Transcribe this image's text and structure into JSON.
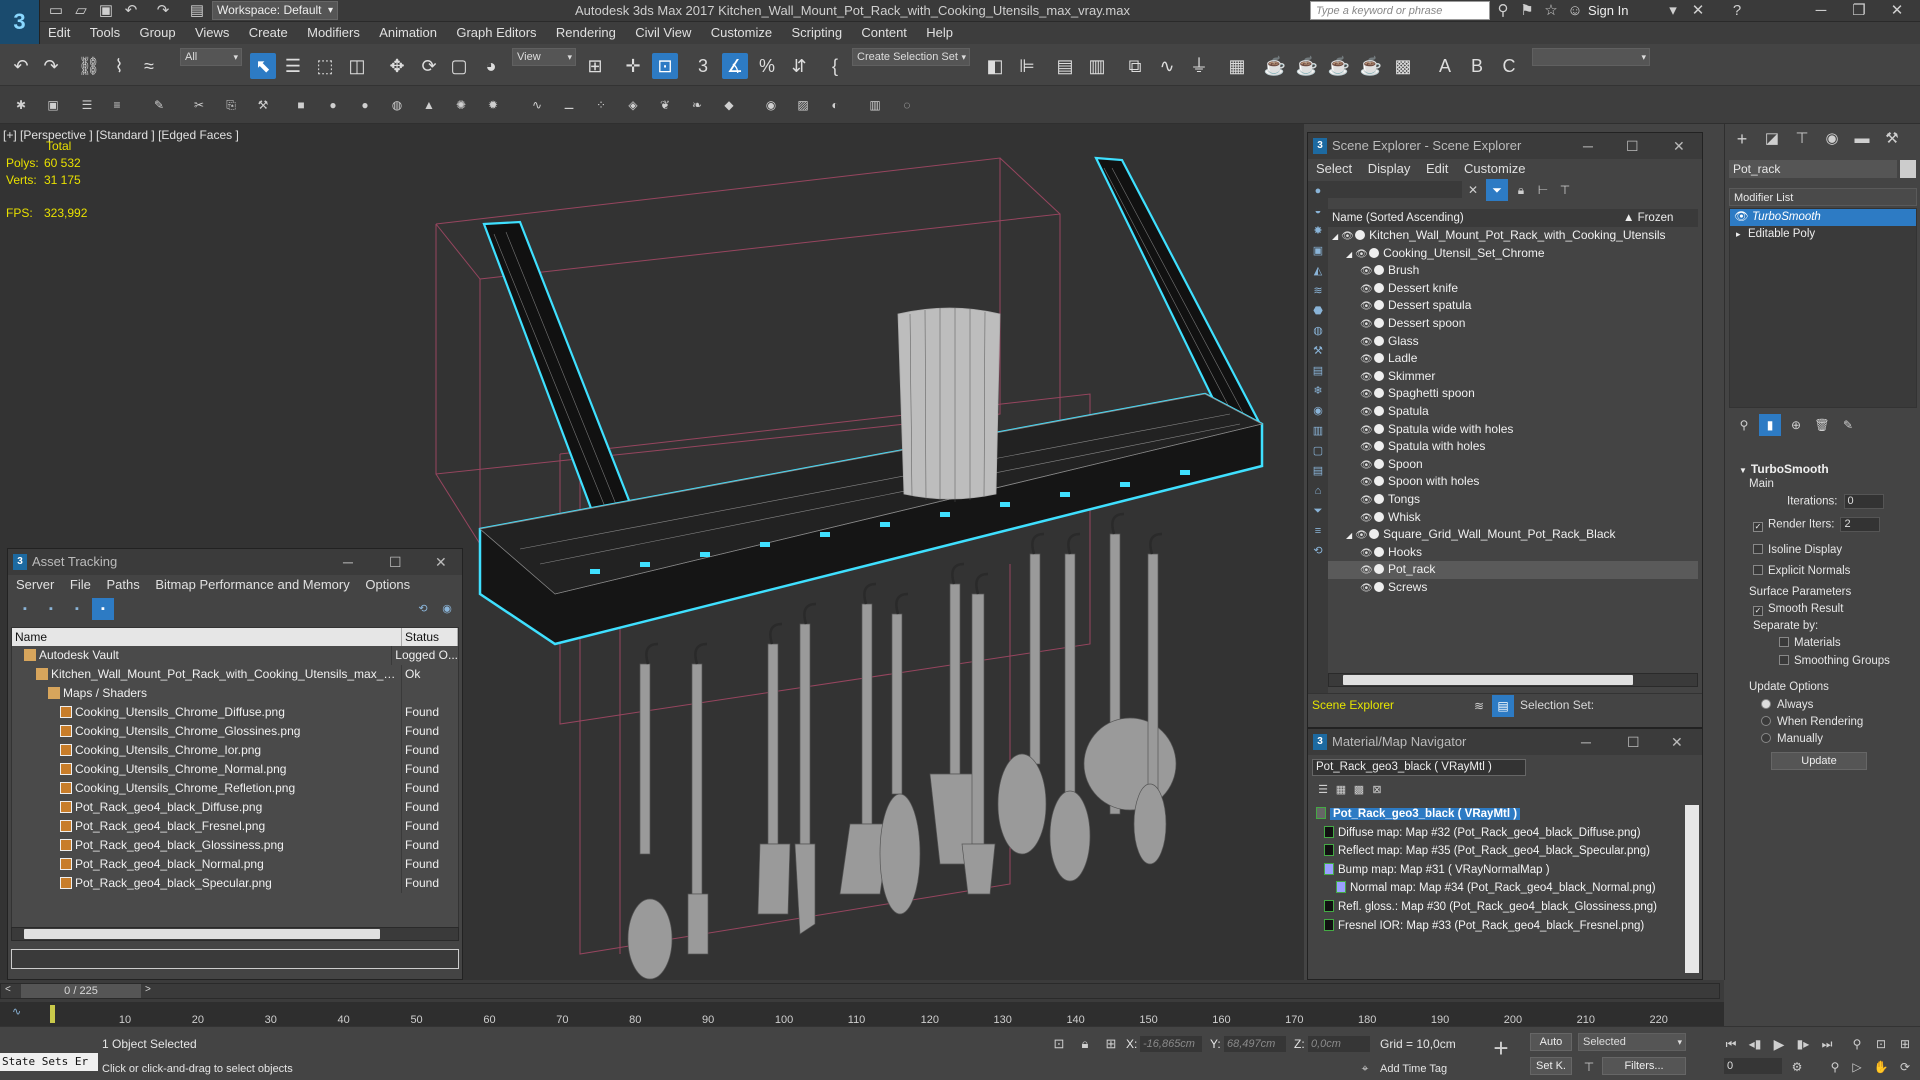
{
  "title_bar": {
    "workspace": "Workspace: Default",
    "app_title": "Autodesk 3ds Max 2017      Kitchen_Wall_Mount_Pot_Rack_with_Cooking_Utensils_max_vray.max",
    "search_placeholder": "Type a keyword or phrase",
    "sign_in": "Sign In"
  },
  "menu": [
    "Edit",
    "Tools",
    "Group",
    "Views",
    "Create",
    "Modifiers",
    "Animation",
    "Graph Editors",
    "Rendering",
    "Civil View",
    "Customize",
    "Scripting",
    "Content",
    "Help"
  ],
  "toolbar": {
    "filter": "All",
    "ref_coord": "View",
    "selection_set": "Create Selection Set"
  },
  "viewport": {
    "label": "[+] [Perspective ] [Standard ] [Edged Faces ]",
    "stats_total": "Total",
    "polys_label": "Polys:",
    "polys": "60 532",
    "verts_label": "Verts:",
    "verts": "31 175",
    "fps_label": "FPS:",
    "fps": "323,992"
  },
  "asset_tracking": {
    "title": "Asset Tracking",
    "menu": [
      "Server",
      "File",
      "Paths",
      "Bitmap Performance and Memory",
      "Options"
    ],
    "col_name": "Name",
    "col_status": "Status",
    "rows": [
      {
        "name": "Autodesk Vault",
        "status": "Logged O...",
        "indent": 1,
        "kind": "vault"
      },
      {
        "name": "Kitchen_Wall_Mount_Pot_Rack_with_Cooking_Utensils_max_vra...",
        "status": "Ok",
        "indent": 2,
        "kind": "max"
      },
      {
        "name": "Maps / Shaders",
        "status": "",
        "indent": 3,
        "kind": "folder"
      },
      {
        "name": "Cooking_Utensils_Chrome_Diffuse.png",
        "status": "Found",
        "indent": 4,
        "kind": "file"
      },
      {
        "name": "Cooking_Utensils_Chrome_Glossines.png",
        "status": "Found",
        "indent": 4,
        "kind": "file"
      },
      {
        "name": "Cooking_Utensils_Chrome_Ior.png",
        "status": "Found",
        "indent": 4,
        "kind": "file"
      },
      {
        "name": "Cooking_Utensils_Chrome_Normal.png",
        "status": "Found",
        "indent": 4,
        "kind": "file"
      },
      {
        "name": "Cooking_Utensils_Chrome_Refletion.png",
        "status": "Found",
        "indent": 4,
        "kind": "file"
      },
      {
        "name": "Pot_Rack_geo4_black_Diffuse.png",
        "status": "Found",
        "indent": 4,
        "kind": "file"
      },
      {
        "name": "Pot_Rack_geo4_black_Fresnel.png",
        "status": "Found",
        "indent": 4,
        "kind": "file"
      },
      {
        "name": "Pot_Rack_geo4_black_Glossiness.png",
        "status": "Found",
        "indent": 4,
        "kind": "file"
      },
      {
        "name": "Pot_Rack_geo4_black_Normal.png",
        "status": "Found",
        "indent": 4,
        "kind": "file"
      },
      {
        "name": "Pot_Rack_geo4_black_Specular.png",
        "status": "Found",
        "indent": 4,
        "kind": "file"
      }
    ]
  },
  "scene_explorer": {
    "title": "Scene Explorer - Scene Explorer",
    "menu": [
      "Select",
      "Display",
      "Edit",
      "Customize"
    ],
    "col_name": "Name (Sorted Ascending)",
    "col_frozen": "▲ Frozen",
    "footer_name": "Scene Explorer",
    "selection_set": "Selection Set:",
    "tree": [
      {
        "label": "Kitchen_Wall_Mount_Pot_Rack_with_Cooking_Utensils",
        "level": 0,
        "selected": false
      },
      {
        "label": "Cooking_Utensil_Set_Chrome",
        "level": 1,
        "selected": false
      },
      {
        "label": "Brush",
        "level": 2,
        "selected": false
      },
      {
        "label": "Dessert knife",
        "level": 2,
        "selected": false
      },
      {
        "label": "Dessert spatula",
        "level": 2,
        "selected": false
      },
      {
        "label": "Dessert spoon",
        "level": 2,
        "selected": false
      },
      {
        "label": "Glass",
        "level": 2,
        "selected": false
      },
      {
        "label": "Ladle",
        "level": 2,
        "selected": false
      },
      {
        "label": "Skimmer",
        "level": 2,
        "selected": false
      },
      {
        "label": "Spaghetti spoon",
        "level": 2,
        "selected": false
      },
      {
        "label": "Spatula",
        "level": 2,
        "selected": false
      },
      {
        "label": "Spatula wide with holes",
        "level": 2,
        "selected": false
      },
      {
        "label": "Spatula with holes",
        "level": 2,
        "selected": false
      },
      {
        "label": "Spoon",
        "level": 2,
        "selected": false
      },
      {
        "label": "Spoon with holes",
        "level": 2,
        "selected": false
      },
      {
        "label": "Tongs",
        "level": 2,
        "selected": false
      },
      {
        "label": "Whisk",
        "level": 2,
        "selected": false
      },
      {
        "label": "Square_Grid_Wall_Mount_Pot_Rack_Black",
        "level": 1,
        "selected": false
      },
      {
        "label": "Hooks",
        "level": 2,
        "selected": false
      },
      {
        "label": "Pot_rack",
        "level": 2,
        "selected": true
      },
      {
        "label": "Screws",
        "level": 2,
        "selected": false
      }
    ]
  },
  "material_navigator": {
    "title": "Material/Map Navigator",
    "current": "Pot_Rack_geo3_black  ( VRayMtl )",
    "rows": [
      {
        "label": "Pot_Rack_geo3_black  ( VRayMtl )",
        "root": true
      },
      {
        "label": "Diffuse map: Map #32 (Pot_Rack_geo4_black_Diffuse.png)",
        "root": false
      },
      {
        "label": "Reflect map: Map #35 (Pot_Rack_geo4_black_Specular.png)",
        "root": false
      },
      {
        "label": "Bump map: Map #31  ( VRayNormalMap )",
        "root": false
      },
      {
        "label": "Normal map: Map #34 (Pot_Rack_geo4_black_Normal.png)",
        "root": false
      },
      {
        "label": "Refl. gloss.: Map #30 (Pot_Rack_geo4_black_Glossiness.png)",
        "root": false
      },
      {
        "label": "Fresnel IOR: Map #33 (Pot_Rack_geo4_black_Fresnel.png)",
        "root": false
      }
    ]
  },
  "command_panel": {
    "object_name": "Pot_rack",
    "modifier_list": "Modifier List",
    "stack": [
      "TurboSmooth",
      "Editable Poly"
    ],
    "rollout": "TurboSmooth",
    "main": "Main",
    "iterations_label": "Iterations:",
    "iterations": "0",
    "render_iters_label": "Render Iters:",
    "render_iters": "2",
    "isoline": "Isoline Display",
    "explicit_normals": "Explicit Normals",
    "surface_params": "Surface Parameters",
    "smooth_result": "Smooth Result",
    "separate_by": "Separate by:",
    "materials": "Materials",
    "smoothing_groups": "Smoothing Groups",
    "update_options": "Update Options",
    "always": "Always",
    "when_rendering": "When Rendering",
    "manually": "Manually",
    "update": "Update"
  },
  "timeline": {
    "frame": "0 / 225",
    "ticks": [
      "10",
      "20",
      "30",
      "40",
      "50",
      "60",
      "70",
      "80",
      "90",
      "100",
      "110",
      "120",
      "130",
      "140",
      "150",
      "160",
      "170",
      "180",
      "190",
      "200",
      "210",
      "220"
    ]
  },
  "status": {
    "maxscript": "State Sets Er",
    "selected": "1 Object Selected",
    "prompt": "Click or click-and-drag to select objects",
    "x_label": "X:",
    "x": "-16,865cm",
    "y_label": "Y:",
    "y": "68,497cm",
    "z_label": "Z:",
    "z": "0,0cm",
    "grid": "Grid = 10,0cm",
    "add_time_tag": "Add Time Tag",
    "auto": "Auto",
    "set_k": "Set K.",
    "selected_dd": "Selected",
    "filters": "Filters...",
    "frame_field": "0"
  },
  "colors": {
    "accent": "#2d7bc4",
    "selection_wire": "#3fe0ff",
    "stats": "#e8e000"
  }
}
